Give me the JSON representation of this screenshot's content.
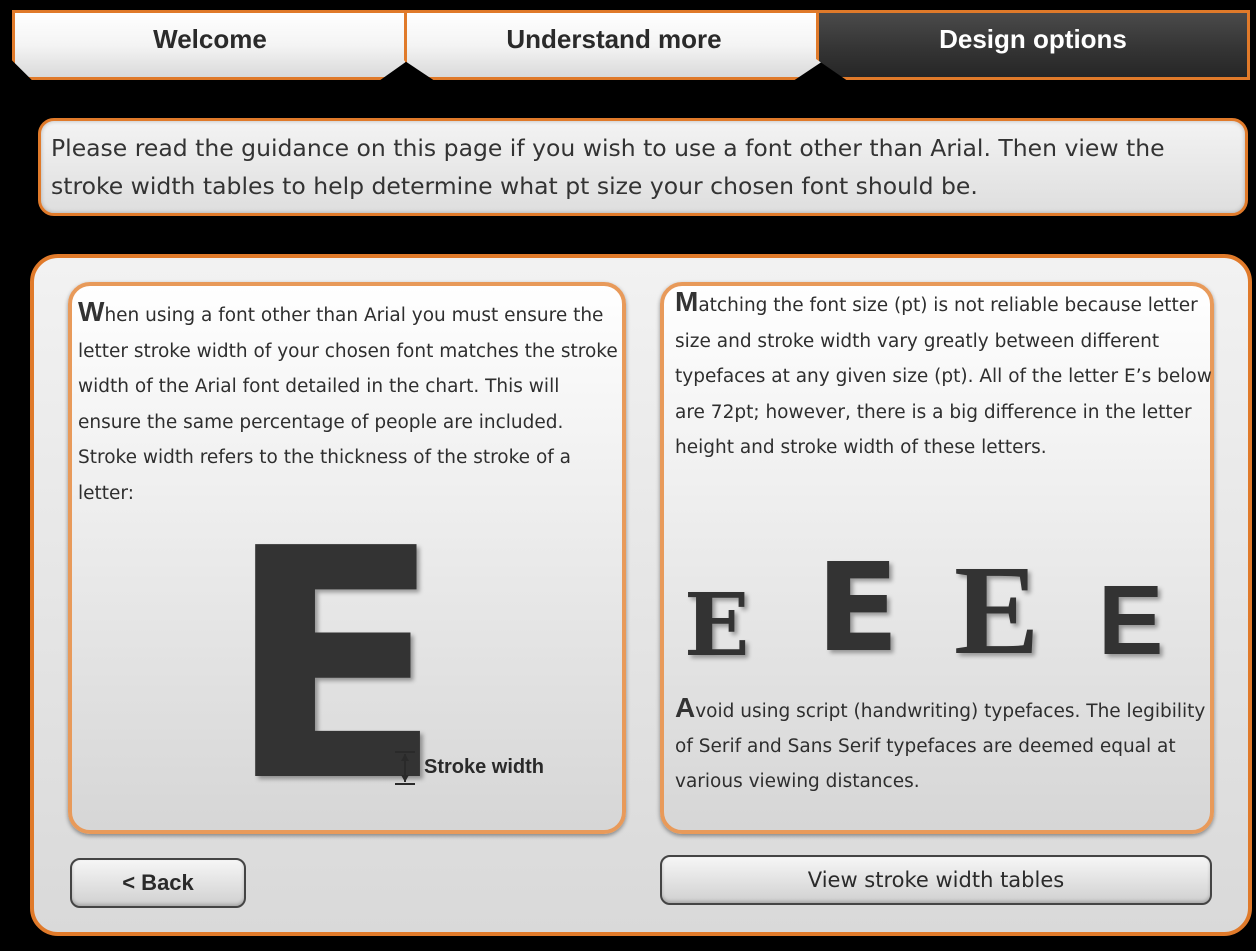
{
  "tabs": [
    {
      "label": "Welcome"
    },
    {
      "label": "Understand more"
    },
    {
      "label": "Design options"
    }
  ],
  "intro": {
    "text": "Please read the guidance on this page if you wish to use a font other than Arial. Then view the stroke width tables to help determine what pt size your chosen font should be."
  },
  "left_card": {
    "dropcap": "W",
    "text": "hen using a font other than Arial you must ensure the letter stroke width of your chosen font matches the stroke width of the  Arial font detailed in the chart. This will ensure the same percentage of people are included.  Stroke width refers to the thickness of the stroke of a letter:",
    "big_letter": "E",
    "stroke_label": "Stroke width"
  },
  "right_card": {
    "dropcap": "M",
    "text": "atching the font size (pt) is not reliable because letter size and stroke width vary greatly between different typefaces at any given size (pt).  All of the letter E’s below are 72pt; however, there is a big difference in the letter height and stroke width of these letters.",
    "samples": [
      "E",
      "E",
      "E",
      "E"
    ],
    "avoid_dropcap": "A",
    "avoid_text": "void using script (handwriting) typefaces. The legibility of Serif and Sans Serif typefaces are deemed equal at various viewing distances."
  },
  "buttons": {
    "back": "< Back",
    "tables": "View stroke width tables"
  },
  "colors": {
    "accent": "#e07a2a",
    "panel": "#e6e6e6",
    "background": "#000000",
    "active_tab": "#333333"
  }
}
